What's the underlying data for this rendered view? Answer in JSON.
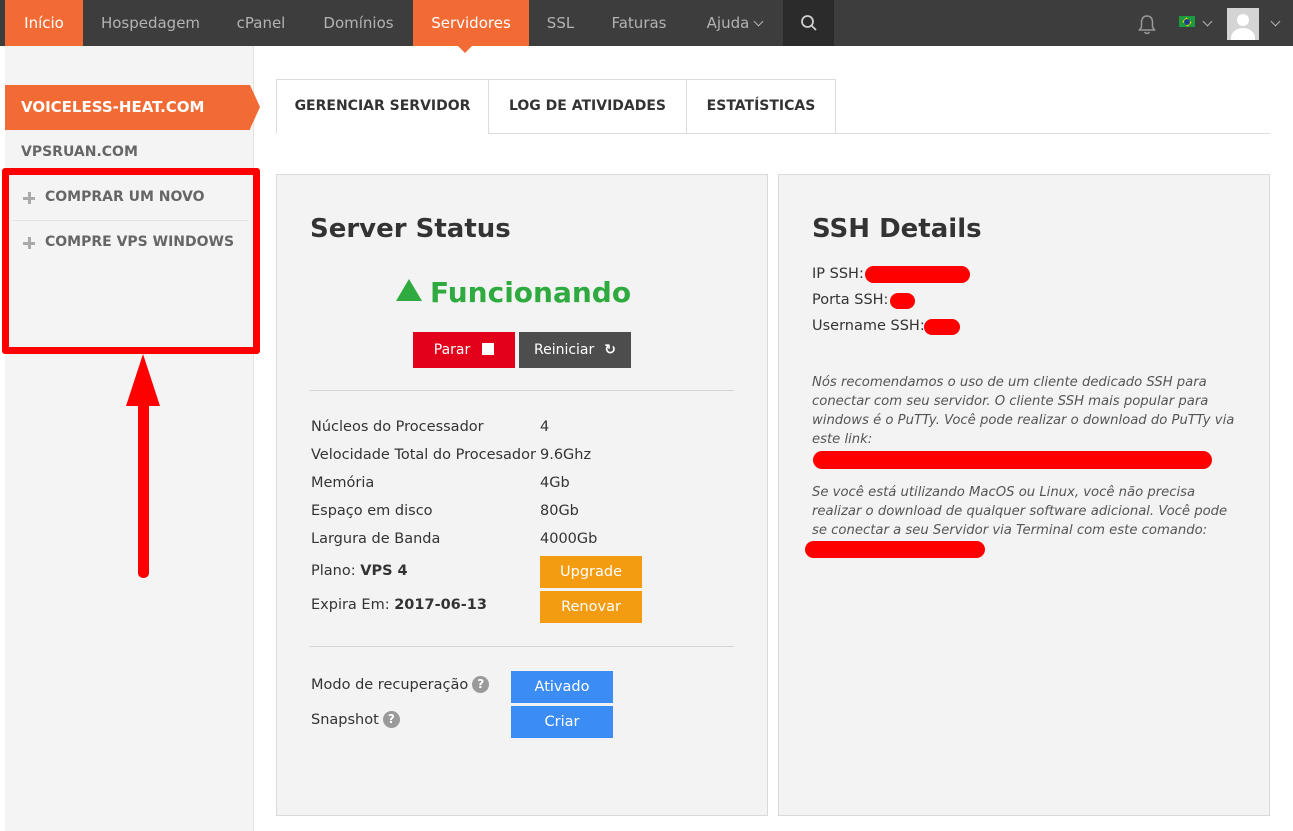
{
  "nav": {
    "items": [
      "Início",
      "Hospedagem",
      "cPanel",
      "Domínios",
      "Servidores",
      "SSL",
      "Faturas",
      "Ajuda"
    ],
    "active_item": "Servidores"
  },
  "sidebar": {
    "active_server": "VOICELESS-HEAT.COM",
    "second_server": "VPSRUAN.COM",
    "buy_new": "COMPRAR UM NOVO",
    "buy_windows": "COMPRE VPS WINDOWS"
  },
  "tabs": [
    "GERENCIAR SERVIDOR",
    "LOG DE ATIVIDADES",
    "ESTATÍSTICAS"
  ],
  "server_status": {
    "title": "Server Status",
    "status": "Funcionando",
    "stop_label": "Parar",
    "restart_label": "Reiniciar",
    "specs": [
      {
        "label": "Núcleos do Processador",
        "value": "4"
      },
      {
        "label": "Velocidade Total do Procesador",
        "value": "9.6Ghz"
      },
      {
        "label": "Memória",
        "value": "4Gb"
      },
      {
        "label": "Espaço em disco",
        "value": "80Gb"
      },
      {
        "label": "Largura de Banda",
        "value": "4000Gb"
      }
    ],
    "plan_label": "Plano:",
    "plan_value": "VPS 4",
    "upgrade_label": "Upgrade",
    "expires_label": "Expira Em:",
    "expires_value": "2017-06-13",
    "renew_label": "Renovar",
    "recovery_label": "Modo de recuperação",
    "recovery_button": "Ativado",
    "snapshot_label": "Snapshot",
    "snapshot_button": "Criar"
  },
  "ssh": {
    "title": "SSH Details",
    "ip_label": "IP SSH:",
    "port_label": "Porta SSH:",
    "username_label": "Username SSH:",
    "note_windows": "Nós recomendamos o uso de um cliente dedicado SSH para conectar com seu servidor. O cliente SSH mais popular para windows é o PuTTy. Você pode realizar o download do PuTTy via este link:",
    "note_mac": "Se você está utilizando MacOS ou Linux, você não precisa realizar o download de qualquer software adicional. Você pode se conectar a seu Servidor via Terminal com este comando:"
  },
  "colors": {
    "brand_orange": "#f26b35",
    "status_green": "#2eaa3f",
    "stop_red": "#e3001b",
    "action_orange": "#f39c12",
    "action_blue": "#3b8cf5",
    "annotation_red": "#ff0000"
  },
  "icons": [
    "bell-icon",
    "brazil-flag-icon",
    "avatar-icon",
    "search-icon",
    "chevron-down-icon",
    "plus-icon",
    "stop-icon",
    "refresh-icon",
    "help-icon",
    "up-triangle-icon"
  ]
}
